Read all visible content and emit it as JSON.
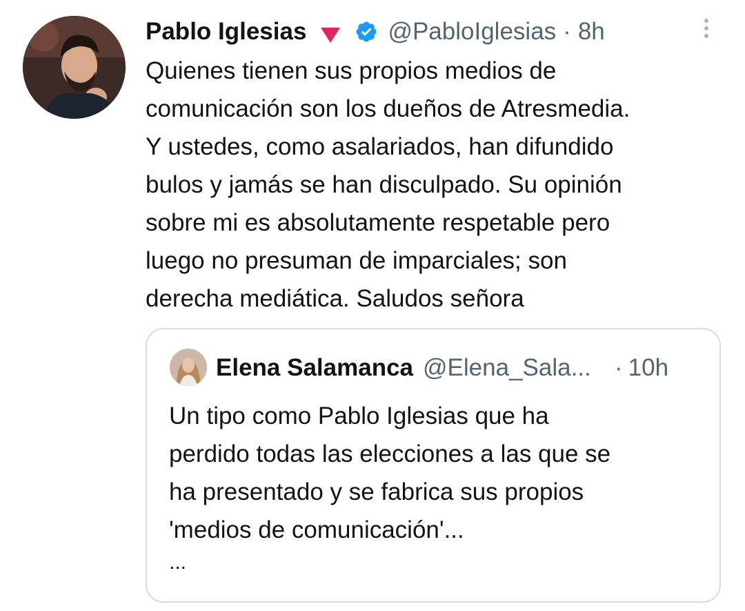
{
  "tweet": {
    "author_name": "Pablo Iglesias",
    "author_handle": "@PabloIglesias",
    "separator": "·",
    "time": "8h",
    "author_rose_icon": "red-triangle-emoji-icon",
    "verified_icon": "verified-badge-icon",
    "verified_color": "#1d9bf0",
    "more_icon": "vertical-ellipsis-icon",
    "text_lines": [
      "Quienes tienen sus propios medios de",
      "comunicación son los dueños de Atresmedia.",
      "Y ustedes, como asalariados, han difundido",
      "bulos y jamás se han disculpado. Su opinión",
      "sobre mi es absolutamente respetable pero",
      "luego no presuman de imparciales; son",
      "derecha mediática. Saludos señora"
    ]
  },
  "quoted_tweet": {
    "author_name": "Elena Salamanca",
    "author_handle": "@Elena_Sala...",
    "separator": "·",
    "time": "10h",
    "text_lines": [
      "Un tipo como Pablo Iglesias que ha",
      "perdido todas las elecciones a las que se",
      "ha presentado y se fabrica sus propios",
      "'medios de comunicación'..."
    ],
    "truncation": "..."
  },
  "colors": {
    "text_primary": "#0f1419",
    "text_secondary": "#536471",
    "border": "#d5dce0",
    "accent_rose": "#e0245e"
  }
}
